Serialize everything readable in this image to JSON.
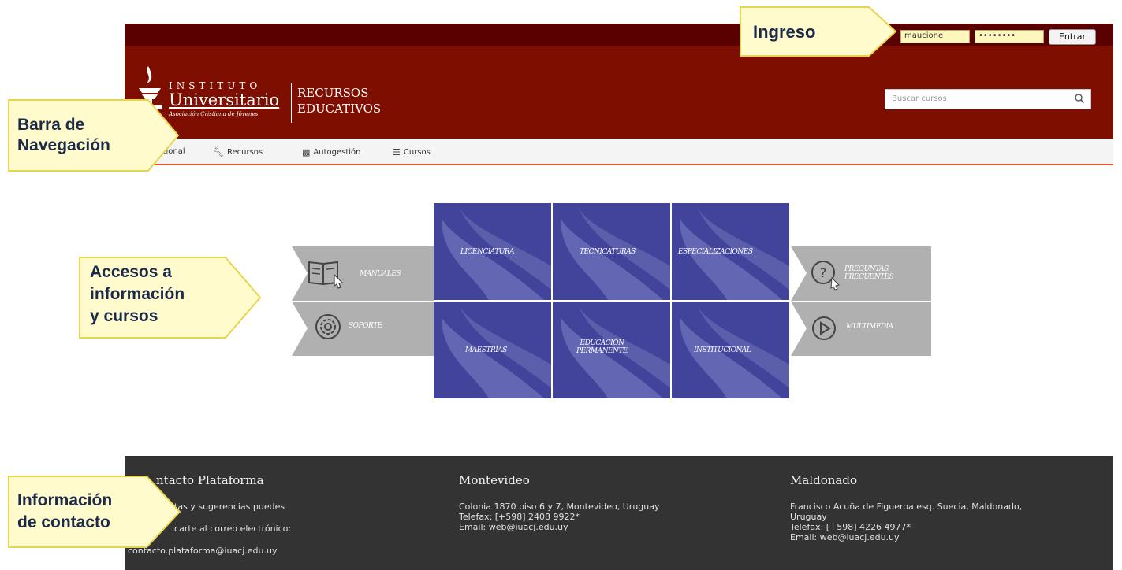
{
  "login": {
    "username_value": "maucione",
    "password_value": "••••••••",
    "submit_label": "Entrar"
  },
  "brand": {
    "institute": "INSTITUTO",
    "university": "Universitario",
    "association": "Asociación Cristiana de Jóvenes",
    "section_line1": "RECURSOS",
    "section_line2": "EDUCATIVOS"
  },
  "search": {
    "placeholder": "Buscar cursos",
    "icon": "search-icon"
  },
  "nav": {
    "items": [
      {
        "label": "cional",
        "icon": ""
      },
      {
        "label": "Recursos",
        "icon": "wrench-icon"
      },
      {
        "label": "Autogestión",
        "icon": "mobile-icon"
      },
      {
        "label": "Cursos",
        "icon": "list-icon"
      }
    ]
  },
  "tiles": {
    "manuales": "MANUALES",
    "soporte": "SOPORTE",
    "licenciatura": "LICENCIATURA",
    "tecnicaturas": "TECNICATURAS",
    "especializaciones": "ESPECIALIZACIONES",
    "maestrias": "MAESTRÍAS",
    "educacion_line1": "EDUCACIÓN",
    "educacion_line2": "PERMANENTE",
    "institucional": "INSTITUCIONAL",
    "preguntas_line1": "PREGUNTAS",
    "preguntas_line2": "FRECUENTES",
    "multimedia": "MULTIMEDIA"
  },
  "footer": {
    "contacto": {
      "title": "ntacto Plataforma",
      "line1": "ltas y sugerencias puedes",
      "line2": "icarte al correo electrónico:",
      "line3": "contacto.plataforma@iuacj.edu.uy"
    },
    "montevideo": {
      "title": "Montevideo",
      "line1": "Colonia 1870 piso 6 y 7, Montevideo, Uruguay",
      "line2": "Telefax: [+598] 2408 9922*",
      "line3": "Email: web@iuacj.edu.uy"
    },
    "maldonado": {
      "title": "Maldonado",
      "line1": "Francisco Acuña de Figueroa esq. Suecia, Maldonado,",
      "line2": "Uruguay",
      "line3": "Telefax: [+598] 4226 4977*",
      "line4": "Email: web@iuacj.edu.uy"
    }
  },
  "callouts": {
    "ingreso": "Ingreso",
    "barra_line1": "Barra de",
    "barra_line2": "Navegación",
    "accesos_line1": "Accesos a",
    "accesos_line2": "información",
    "accesos_line3": "y cursos",
    "info_line1": "Información",
    "info_line2": "de contacto"
  },
  "colors": {
    "topbar": "#5a0000",
    "header": "#7d0e00",
    "tile_blue": "#41449a",
    "tile_grey": "#b0b0b0",
    "footer": "#333333",
    "nav_accent": "#e5542e",
    "callout_fill": "#fffbcc"
  }
}
